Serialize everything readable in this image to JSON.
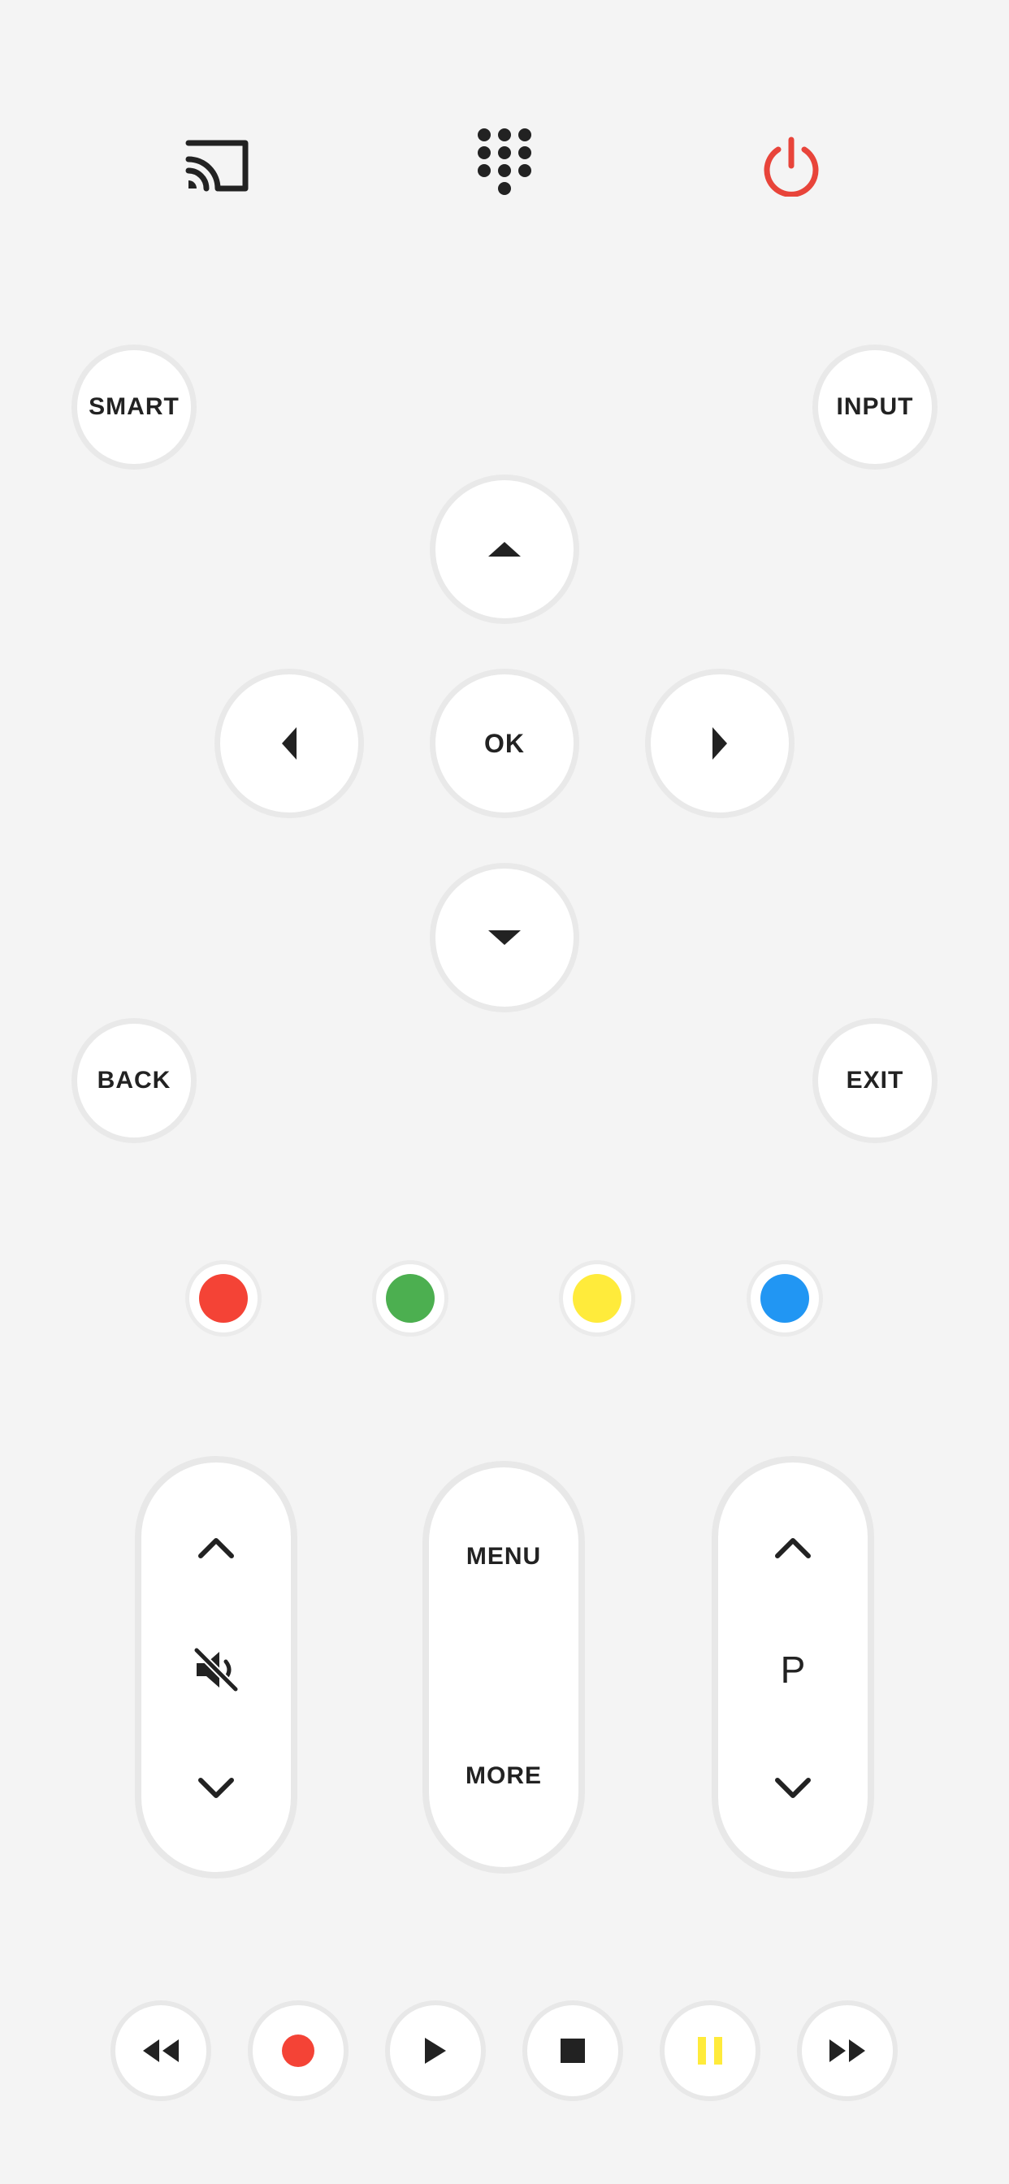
{
  "top": {
    "cast_icon": "cast-icon",
    "keypad_icon": "dialpad-icon",
    "power_icon": "power-icon",
    "power_color": "#e8443a"
  },
  "buttons": {
    "smart": "SMART",
    "input": "INPUT",
    "ok": "OK",
    "back": "BACK",
    "exit": "EXIT"
  },
  "color_keys": [
    {
      "name": "red",
      "color": "#f44336"
    },
    {
      "name": "green",
      "color": "#4caf50"
    },
    {
      "name": "yellow",
      "color": "#ffeb3b"
    },
    {
      "name": "blue",
      "color": "#2196f3"
    }
  ],
  "volume": {
    "up_icon": "chevron-up-icon",
    "mute_icon": "mute-icon",
    "down_icon": "chevron-down-icon"
  },
  "menu_pill": {
    "menu": "MENU",
    "more": "MORE"
  },
  "channel": {
    "label": "P",
    "up_icon": "chevron-up-icon",
    "down_icon": "chevron-down-icon"
  },
  "media": {
    "rewind": "rewind-icon",
    "record": "record-icon",
    "record_color": "#f44336",
    "play": "play-icon",
    "stop": "stop-icon",
    "pause": "pause-icon",
    "pause_color": "#ffeb3b",
    "fast_forward": "fast-forward-icon"
  }
}
